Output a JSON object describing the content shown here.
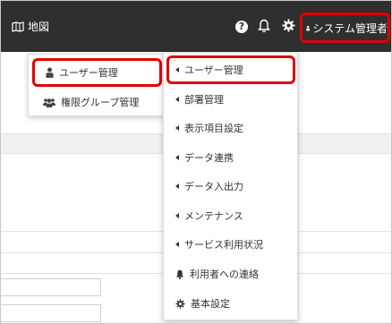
{
  "topbar": {
    "map_label": "地図",
    "help_glyph": "?",
    "user_label": "システム管理者"
  },
  "menu_left": {
    "items": [
      {
        "label": "ユーザー管理",
        "icon": "user-icon"
      },
      {
        "label": "権限グループ管理",
        "icon": "users-group-icon"
      }
    ]
  },
  "menu_right": {
    "items": [
      {
        "label": "ユーザー管理",
        "icon": "caret-left-icon"
      },
      {
        "label": "部署管理",
        "icon": "caret-left-icon"
      },
      {
        "label": "表示項目設定",
        "icon": "caret-left-icon"
      },
      {
        "label": "データ連携",
        "icon": "caret-left-icon"
      },
      {
        "label": "データ入出力",
        "icon": "caret-left-icon"
      },
      {
        "label": "メンテナンス",
        "icon": "caret-left-icon"
      },
      {
        "label": "サービス利用状況",
        "icon": "caret-left-icon"
      },
      {
        "label": "利用者への連絡",
        "icon": "bell-icon"
      },
      {
        "label": "基本設定",
        "icon": "gear-icon"
      }
    ]
  },
  "colors": {
    "topbar": "#2f2f2f",
    "highlight": "#e00000"
  }
}
